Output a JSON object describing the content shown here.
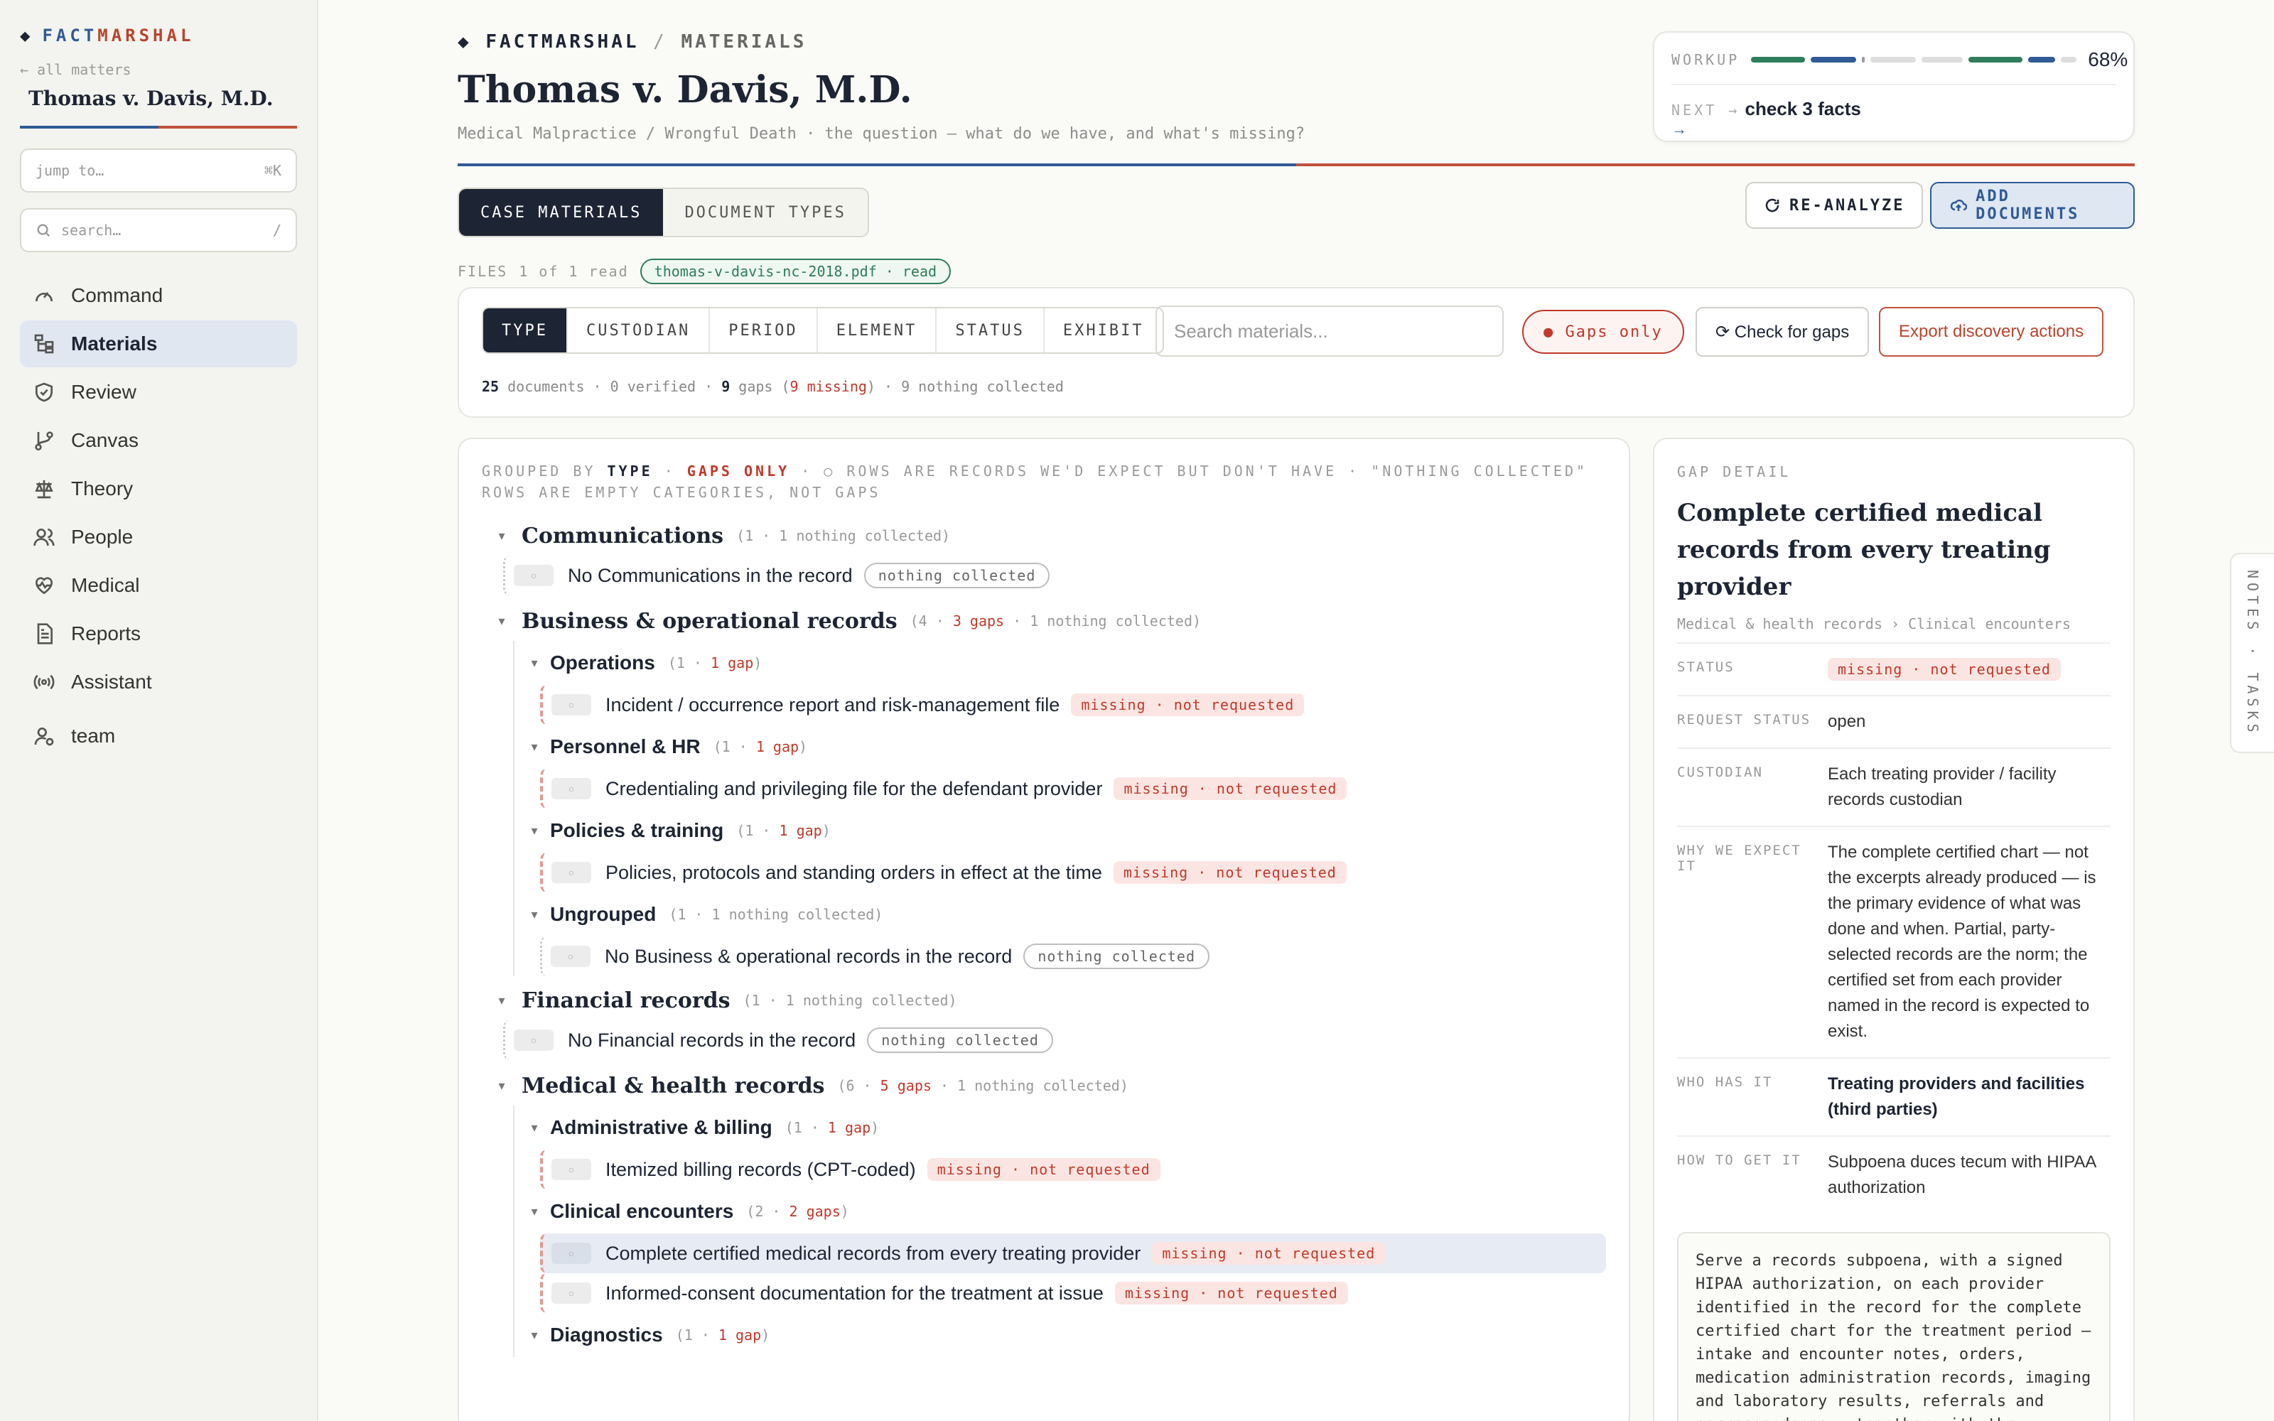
{
  "brand": {
    "prefix": "◆",
    "fact": "FACT",
    "marshal": "MARSHAL"
  },
  "sidebar": {
    "back": "← all matters",
    "matter": "Thomas v. Davis, M.D.",
    "jump_placeholder": "jump to…",
    "jump_key": "⌘K",
    "search_placeholder": "search…",
    "search_key": "/",
    "items": [
      {
        "label": "Command",
        "icon": "gauge-icon"
      },
      {
        "label": "Materials",
        "icon": "folder-tree-icon"
      },
      {
        "label": "Review",
        "icon": "shield-check-icon"
      },
      {
        "label": "Canvas",
        "icon": "git-branch-icon"
      },
      {
        "label": "Theory",
        "icon": "scale-icon"
      },
      {
        "label": "People",
        "icon": "users-icon"
      },
      {
        "label": "Medical",
        "icon": "heart-pulse-icon"
      },
      {
        "label": "Reports",
        "icon": "file-text-icon"
      },
      {
        "label": "Assistant",
        "icon": "radio-icon"
      },
      {
        "label": "team",
        "icon": "user-cog-icon"
      }
    ]
  },
  "header": {
    "crumb_brand": "FACTMARSHAL",
    "crumb_sep": "/",
    "crumb_page": "MATERIALS",
    "title": "Thomas v. Davis, M.D.",
    "subtitle": "Medical Malpractice / Wrongful Death · the question — what do we have, and what's missing?"
  },
  "workup": {
    "label": "WORKUP",
    "percent": "68%",
    "progress": 0.68,
    "next_label": "NEXT →",
    "next_text": "check 3 facts",
    "arrow": "→"
  },
  "tabs": [
    "CASE MATERIALS",
    "DOCUMENT TYPES"
  ],
  "actions": {
    "reanalyze": "RE-ANALYZE",
    "add": "ADD DOCUMENTS"
  },
  "files": {
    "label": "FILES",
    "count": "1 of 1 read",
    "chip": "thomas-v-davis-nc-2018.pdf · read"
  },
  "filters": {
    "segments": [
      "TYPE",
      "CUSTODIAN",
      "PERIOD",
      "ELEMENT",
      "STATUS",
      "EXHIBIT"
    ],
    "search_placeholder": "Search materials...",
    "gaps_only": "● Gaps only",
    "check": "⟳ Check for gaps",
    "export": "Export discovery actions",
    "docs": "25",
    "docs_label": "documents ·",
    "verified": "0 verified ·",
    "gaps": "9",
    "gaps_label": "gaps (",
    "missing": "9 missing",
    "close": ")",
    "nothing": "· 9 nothing collected"
  },
  "list": {
    "hdr_a": "GROUPED BY",
    "hdr_type": "TYPE",
    "hdr_dot": "·",
    "hdr_gaps": "GAPS ONLY",
    "hdr_rest": "· ○ ROWS ARE RECORDS WE'D EXPECT BUT DON'T HAVE · \"NOTHING COLLECTED\" ROWS ARE EMPTY CATEGORIES, NOT GAPS",
    "missing_pill": "missing · not requested",
    "nc_pill": "nothing collected",
    "g1": {
      "name": "Communications",
      "meta": "(1 · 1 nothing collected)",
      "item": "No Communications in the record"
    },
    "g2": {
      "name": "Business & operational records",
      "meta_a": "(4 ·",
      "meta_b": "3 gaps",
      "meta_c": "· 1 nothing collected)",
      "s1": {
        "name": "Operations",
        "meta_a": "(1 ·",
        "meta_b": "1 gap",
        "meta_c": ")",
        "item": "Incident / occurrence report and risk-management file"
      },
      "s2": {
        "name": "Personnel & HR",
        "meta_a": "(1 ·",
        "meta_b": "1 gap",
        "meta_c": ")",
        "item": "Credentialing and privileging file for the defendant provider"
      },
      "s3": {
        "name": "Policies & training",
        "meta_a": "(1 ·",
        "meta_b": "1 gap",
        "meta_c": ")",
        "item": "Policies, protocols and standing orders in effect at the time"
      },
      "s4": {
        "name": "Ungrouped",
        "meta": "(1 · 1 nothing collected)",
        "item": "No Business & operational records in the record"
      }
    },
    "g3": {
      "name": "Financial records",
      "meta": "(1 · 1 nothing collected)",
      "item": "No Financial records in the record"
    },
    "g4": {
      "name": "Medical & health records",
      "meta_a": "(6 ·",
      "meta_b": "5 gaps",
      "meta_c": "· 1 nothing collected)",
      "s1": {
        "name": "Administrative & billing",
        "meta_a": "(1 ·",
        "meta_b": "1 gap",
        "meta_c": ")",
        "item": "Itemized billing records (CPT-coded)"
      },
      "s2": {
        "name": "Clinical encounters",
        "meta_a": "(2 ·",
        "meta_b": "2 gaps",
        "meta_c": ")",
        "item1": "Complete certified medical records from every treating provider",
        "item2": "Informed-consent documentation for the treatment at issue"
      },
      "s3": {
        "name": "Diagnostics",
        "meta_a": "(1 ·",
        "meta_b": "1 gap",
        "meta_c": ")"
      }
    }
  },
  "detail": {
    "label": "GAP DETAIL",
    "title": "Complete certified medical records from every treating provider",
    "path": "Medical & health records › Clinical encounters",
    "status_k": "STATUS",
    "status_v": "missing · not requested",
    "req_k": "REQUEST STATUS",
    "req_v": "open",
    "cust_k": "CUSTODIAN",
    "cust_v": "Each treating provider / facility records custodian",
    "why_k": "WHY WE EXPECT IT",
    "why_v": "The complete certified chart — not the excerpts already produced — is the primary evidence of what was done and when. Partial, party-selected records are the norm; the certified set from each provider named in the record is expected to exist.",
    "who_k": "WHO HAS IT",
    "who_v": "Treating providers and facilities (third parties)",
    "how_k": "HOW TO GET IT",
    "how_v": "Subpoena duces tecum with HIPAA authorization",
    "note": "Serve a records subpoena, with a signed HIPAA authorization, on each provider identified in the record for the complete certified chart for the treatment period — intake and encounter notes, orders, medication administration records, imaging and laboratory results, referrals and correspondence — together with the custodian's affidavit of completeness."
  },
  "sidetab": "NOTES · TASKS"
}
